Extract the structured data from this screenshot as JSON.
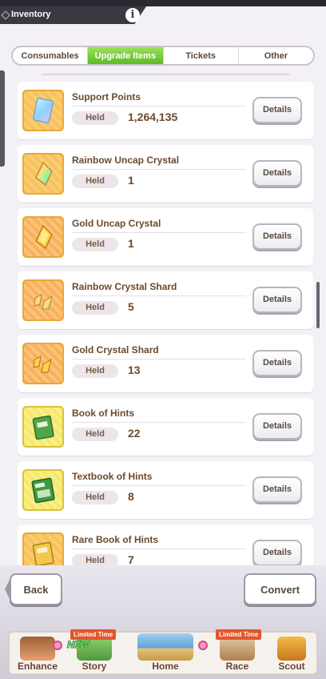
{
  "header": {
    "title": "Inventory",
    "info_glyph": "i"
  },
  "tabs": [
    {
      "label": "Consumables",
      "active": false
    },
    {
      "label": "Upgrade Items",
      "active": true
    },
    {
      "label": "Tickets",
      "active": false
    },
    {
      "label": "Other",
      "active": false
    }
  ],
  "items": [
    {
      "name": "Support Points",
      "held_label": "Held",
      "held": "1,264,135",
      "details": "Details",
      "icon": "support-points-icon"
    },
    {
      "name": "Rainbow Uncap Crystal",
      "held_label": "Held",
      "held": "1",
      "details": "Details",
      "icon": "rainbow-crystal-icon"
    },
    {
      "name": "Gold Uncap Crystal",
      "held_label": "Held",
      "held": "1",
      "details": "Details",
      "icon": "gold-crystal-icon"
    },
    {
      "name": "Rainbow Crystal Shard",
      "held_label": "Held",
      "held": "5",
      "details": "Details",
      "icon": "rainbow-shard-icon"
    },
    {
      "name": "Gold Crystal Shard",
      "held_label": "Held",
      "held": "13",
      "details": "Details",
      "icon": "gold-shard-icon"
    },
    {
      "name": "Book of Hints",
      "held_label": "Held",
      "held": "22",
      "details": "Details",
      "icon": "hint-book-icon"
    },
    {
      "name": "Textbook of Hints",
      "held_label": "Held",
      "held": "8",
      "details": "Details",
      "icon": "textbook-icon"
    },
    {
      "name": "Rare Book of Hints",
      "held_label": "Held",
      "held": "7",
      "details": "Details",
      "icon": "rare-book-icon"
    }
  ],
  "footer": {
    "back": "Back",
    "convert": "Convert"
  },
  "nav": [
    {
      "label": "Enhance",
      "ribbon": "",
      "badge": ""
    },
    {
      "label": "Story",
      "ribbon": "Limited Time",
      "badge": "NEW"
    },
    {
      "label": "Home",
      "ribbon": "",
      "badge": ""
    },
    {
      "label": "Race",
      "ribbon": "Limited Time",
      "badge": ""
    },
    {
      "label": "Scout",
      "ribbon": "",
      "badge": ""
    }
  ],
  "colors": {
    "tab_active": "#5bbb24",
    "text_brown": "#6b4a2e",
    "ribbon": "#e2552c"
  }
}
